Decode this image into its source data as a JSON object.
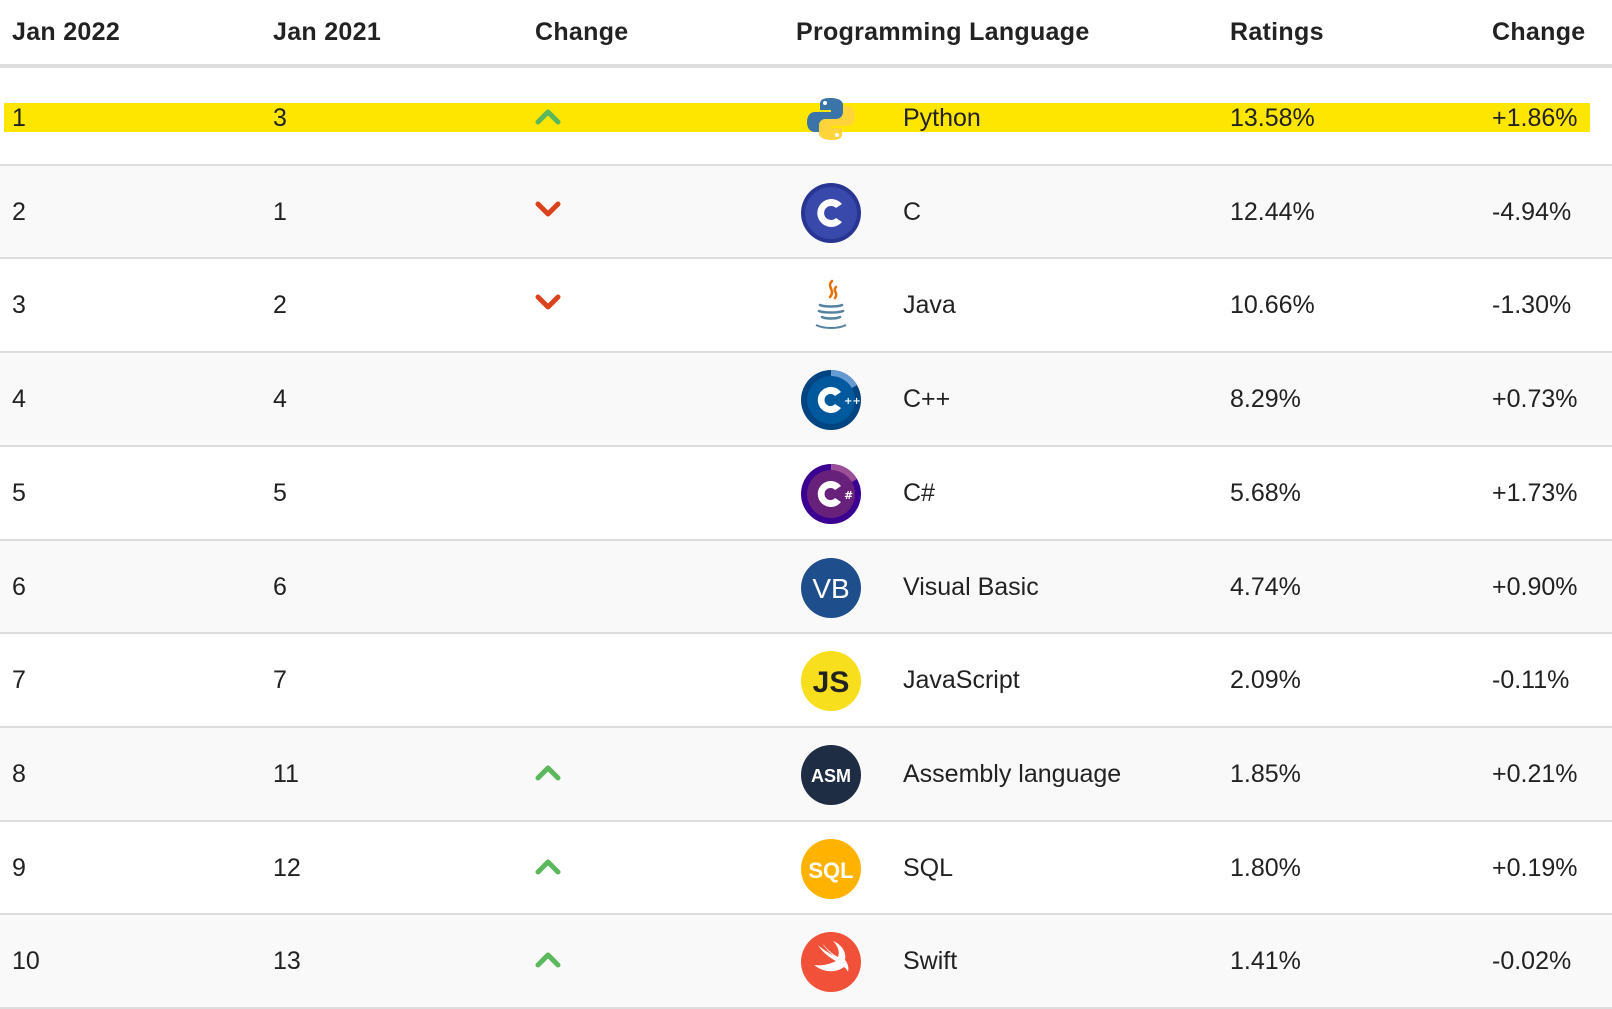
{
  "header": {
    "col_rank_now": "Jan 2022",
    "col_rank_prev": "Jan 2021",
    "col_change_arrow": "Change",
    "col_language": "Programming Language",
    "col_ratings": "Ratings",
    "col_change_pct": "Change"
  },
  "colors": {
    "highlight": "#ffe600",
    "arrow_up": "#5cb85c",
    "arrow_down": "#d9421b",
    "divider": "#dddddd",
    "alt_row": "#f9f9f9"
  },
  "rows": [
    {
      "rank": "1",
      "prev": "3",
      "trend": "up",
      "icon": "python-logo-icon",
      "language": "Python",
      "rating": "13.58%",
      "change": "+1.86%",
      "highlighted": true
    },
    {
      "rank": "2",
      "prev": "1",
      "trend": "down",
      "icon": "c-logo-icon",
      "language": "C",
      "rating": "12.44%",
      "change": "-4.94%"
    },
    {
      "rank": "3",
      "prev": "2",
      "trend": "down",
      "icon": "java-logo-icon",
      "language": "Java",
      "rating": "10.66%",
      "change": "-1.30%"
    },
    {
      "rank": "4",
      "prev": "4",
      "trend": "none",
      "icon": "cpp-logo-icon",
      "language": "C++",
      "rating": "8.29%",
      "change": "+0.73%"
    },
    {
      "rank": "5",
      "prev": "5",
      "trend": "none",
      "icon": "csharp-logo-icon",
      "language": "C#",
      "rating": "5.68%",
      "change": "+1.73%"
    },
    {
      "rank": "6",
      "prev": "6",
      "trend": "none",
      "icon": "visual-basic-logo-icon",
      "icon_text": "VB",
      "language": "Visual Basic",
      "rating": "4.74%",
      "change": "+0.90%"
    },
    {
      "rank": "7",
      "prev": "7",
      "trend": "none",
      "icon": "javascript-logo-icon",
      "icon_text": "JS",
      "language": "JavaScript",
      "rating": "2.09%",
      "change": "-0.11%"
    },
    {
      "rank": "8",
      "prev": "11",
      "trend": "up",
      "icon": "assembly-logo-icon",
      "icon_text": "ASM",
      "language": "Assembly language",
      "rating": "1.85%",
      "change": "+0.21%"
    },
    {
      "rank": "9",
      "prev": "12",
      "trend": "up",
      "icon": "sql-logo-icon",
      "icon_text": "SQL",
      "language": "SQL",
      "rating": "1.80%",
      "change": "+0.19%"
    },
    {
      "rank": "10",
      "prev": "13",
      "trend": "up",
      "icon": "swift-logo-icon",
      "language": "Swift",
      "rating": "1.41%",
      "change": "-0.02%"
    }
  ]
}
